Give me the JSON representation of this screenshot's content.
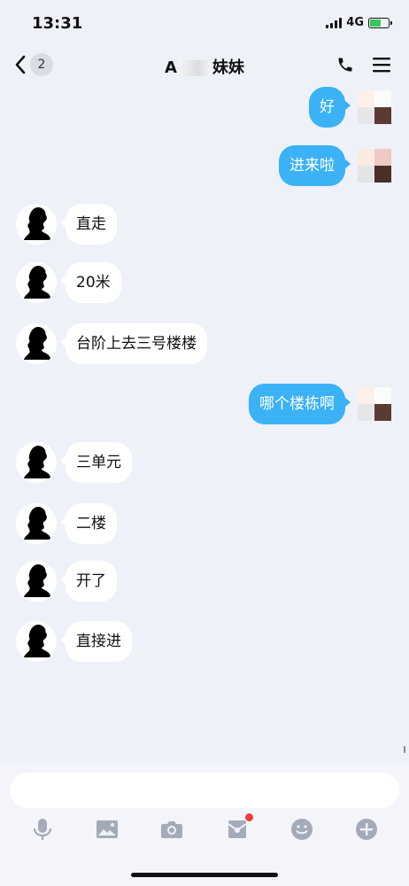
{
  "status_bar": {
    "time": "13:31",
    "network": "4G",
    "battery_charging": true
  },
  "nav": {
    "back_count": "2",
    "title_prefix": "A",
    "title_suffix": "妹妹",
    "icons": [
      "back-chevron-icon",
      "phone-icon",
      "menu-icon"
    ]
  },
  "messages": [
    {
      "side": "out",
      "text": "好"
    },
    {
      "side": "out",
      "text": "进来啦"
    },
    {
      "side": "in",
      "text": "直走"
    },
    {
      "side": "in",
      "text": "20米"
    },
    {
      "side": "in",
      "text": "台阶上去三号楼楼"
    },
    {
      "side": "out",
      "text": "哪个楼栋啊"
    },
    {
      "side": "in",
      "text": "三单元"
    },
    {
      "side": "in",
      "text": "二楼"
    },
    {
      "side": "in",
      "text": "开了"
    },
    {
      "side": "in",
      "text": "直接进"
    }
  ],
  "input": {
    "value": "",
    "placeholder": ""
  },
  "toolbar": {
    "icons": [
      "microphone-icon",
      "image-icon",
      "camera-icon",
      "red-packet-icon",
      "emoji-icon",
      "plus-icon"
    ],
    "red_packet_has_notification": true
  },
  "colors": {
    "accent": "#3bb2f6",
    "background": "#eef1f8",
    "notification": "#f23c3c"
  }
}
